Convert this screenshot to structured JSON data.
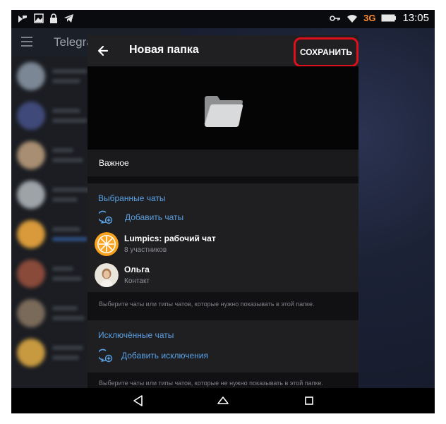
{
  "status_bar": {
    "time": "13:05",
    "network": "3G",
    "icons": [
      "notification-icon",
      "image-icon",
      "lock-icon",
      "telegram-icon",
      "key-icon",
      "wifi-icon",
      "battery-icon"
    ]
  },
  "background_app": {
    "title": "Telegra"
  },
  "panel": {
    "title": "Новая папка",
    "save_label": "СОХРАНИТЬ",
    "folder_name": "Важное",
    "included": {
      "title": "Выбранные чаты",
      "add_label": "Добавить чаты",
      "chats": [
        {
          "name": "Lumpics: рабочий чат",
          "subtitle": "8 участников",
          "avatar": "orange-slice-avatar"
        },
        {
          "name": "Ольга",
          "subtitle": "Контакт",
          "avatar": "person-photo-avatar"
        }
      ],
      "hint": "Выберите чаты или типы чатов, которые нужно показывать в этой папке."
    },
    "excluded": {
      "title": "Исключённые чаты",
      "add_label": "Добавить исключения",
      "hint": "Выберите чаты или типы чатов, которые не нужно показывать в этой папке."
    }
  },
  "colors": {
    "accent": "#5aa0e4",
    "highlight": "#e0101a",
    "panel_bg": "#1f1f21"
  }
}
